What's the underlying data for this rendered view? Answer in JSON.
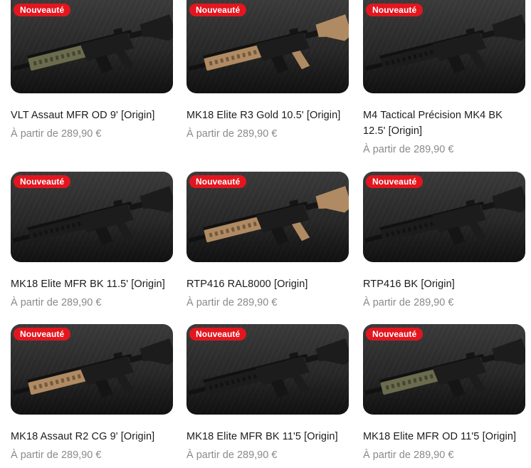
{
  "badge_label": "Nouveauté",
  "price_prefix": "À partir de",
  "products": [
    {
      "title": "VLT Assaut MFR OD 9' [Origin]",
      "price": "289,90 €",
      "handguard": "od",
      "stock": "black",
      "grip": "black"
    },
    {
      "title": "MK18 Elite R3 Gold 10.5' [Origin]",
      "price": "289,90 €",
      "handguard": "tan",
      "stock": "tan",
      "grip": "tan"
    },
    {
      "title": "M4 Tactical Précision MK4 BK 12.5' [Origin]",
      "price": "289,90 €",
      "handguard": "black",
      "stock": "black",
      "grip": "black"
    },
    {
      "title": "MK18 Elite MFR BK 11.5' [Origin]",
      "price": "289,90 €",
      "handguard": "black",
      "stock": "black",
      "grip": "black"
    },
    {
      "title": "RTP416 RAL8000 [Origin]",
      "price": "289,90 €",
      "handguard": "tan",
      "stock": "tan",
      "grip": "tan"
    },
    {
      "title": "RTP416 BK [Origin]",
      "price": "289,90 €",
      "handguard": "black",
      "stock": "black",
      "grip": "black"
    },
    {
      "title": "MK18 Assaut R2 CG 9' [Origin]",
      "price": "289,90 €",
      "handguard": "tan",
      "stock": "black",
      "grip": "black"
    },
    {
      "title": "MK18 Elite MFR BK 11'5 [Origin]",
      "price": "289,90 €",
      "handguard": "black",
      "stock": "black",
      "grip": "black"
    },
    {
      "title": "MK18 Elite MFR OD 11'5 [Origin]",
      "price": "289,90 €",
      "handguard": "od",
      "stock": "black",
      "grip": "black"
    }
  ],
  "colors": {
    "badge": "#e3161f",
    "title": "#1b1b1b",
    "price": "#8a8a8a",
    "black": "#1c1c1c",
    "tan": "#b08a62",
    "od": "#6b6b4e"
  }
}
